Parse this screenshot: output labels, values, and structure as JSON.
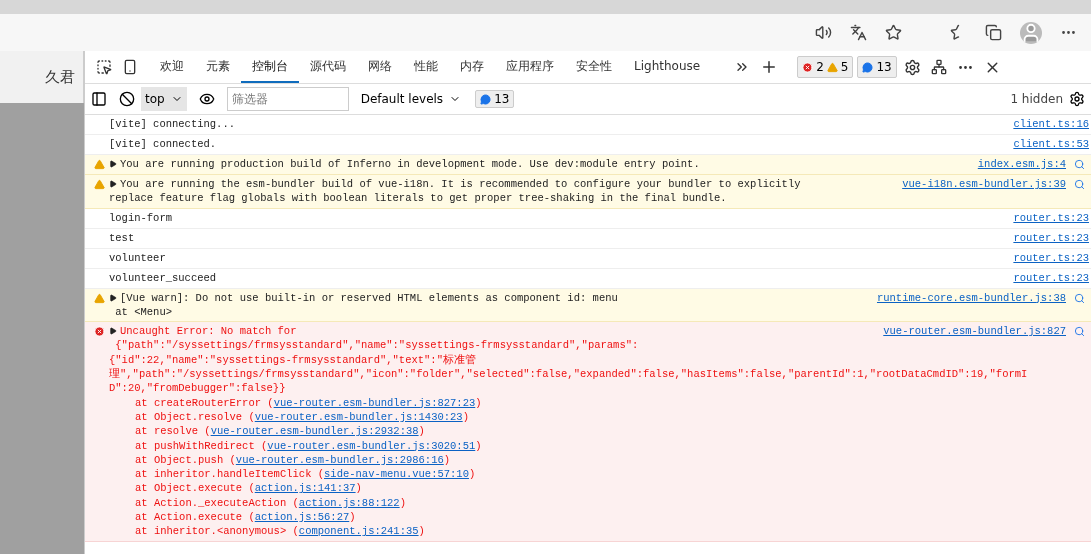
{
  "page": {
    "text": "久君"
  },
  "devtools": {
    "tabs": [
      {
        "label": "欢迎",
        "selected": false
      },
      {
        "label": "元素",
        "selected": false
      },
      {
        "label": "控制台",
        "selected": true
      },
      {
        "label": "源代码",
        "selected": false
      },
      {
        "label": "网络",
        "selected": false
      },
      {
        "label": "性能",
        "selected": false
      },
      {
        "label": "内存",
        "selected": false
      },
      {
        "label": "应用程序",
        "selected": false
      },
      {
        "label": "安全性",
        "selected": false
      },
      {
        "label": "Lighthouse",
        "selected": false
      }
    ],
    "error_count": "2",
    "warning_count": "5",
    "message_count": "13"
  },
  "console_toolbar": {
    "context": "top",
    "filter_placeholder": "筛选器",
    "levels": "Default levels",
    "message_count": "13",
    "hidden": "1 hidden"
  },
  "messages": [
    {
      "kind": "log",
      "lines": [
        "[vite] connecting..."
      ],
      "source": "client.ts:16"
    },
    {
      "kind": "log",
      "lines": [
        "[vite] connected."
      ],
      "source": "client.ts:53"
    },
    {
      "kind": "warning",
      "lines": [
        "You are running production build of Inferno in development mode. Use dev:module entry point."
      ],
      "source": "index.esm.js:4"
    },
    {
      "kind": "warning",
      "lines": [
        "You are running the esm-bundler build of vue-i18n. It is recommended to configure your bundler to explicitly",
        "replace feature flag globals with boolean literals to get proper tree-shaking in the final bundle."
      ],
      "source": "vue-i18n.esm-bundler.js:39"
    },
    {
      "kind": "log",
      "lines": [
        "login-form"
      ],
      "source": "router.ts:23"
    },
    {
      "kind": "log",
      "lines": [
        "test"
      ],
      "source": "router.ts:23"
    },
    {
      "kind": "log",
      "lines": [
        "volunteer"
      ],
      "source": "router.ts:23"
    },
    {
      "kind": "log",
      "lines": [
        "volunteer_succeed"
      ],
      "source": "router.ts:23"
    },
    {
      "kind": "warning",
      "lines": [
        "[Vue warn]: Do not use built-in or reserved HTML elements as component id: menu",
        " at <Menu>"
      ],
      "source": "runtime-core.esm-bundler.js:38"
    },
    {
      "kind": "error",
      "lines": [
        "Uncaught Error: No match for",
        " {\"path\":\"/syssettings/frmsysstandard\",\"name\":\"syssettings-frmsysstandard\",\"params\":",
        "{\"id\":22,\"name\":\"syssettings-frmsysstandard\",\"text\":\"标准管",
        "理\",\"path\":\"/syssettings/frmsysstandard\",\"icon\":\"folder\",\"selected\":false,\"expanded\":false,\"hasItems\":false,\"parentId\":1,\"rootDataCmdID\":19,\"formI",
        "D\":20,\"fromDebugger\":false}}"
      ],
      "source": "vue-router.esm-bundler.js:827",
      "stack": [
        {
          "call": "at createRouterError (",
          "link": "vue-router.esm-bundler.js:827:23",
          "end": ")"
        },
        {
          "call": "at Object.resolve (",
          "link": "vue-router.esm-bundler.js:1430:23",
          "end": ")"
        },
        {
          "call": "at resolve (",
          "link": "vue-router.esm-bundler.js:2932:38",
          "end": ")"
        },
        {
          "call": "at pushWithRedirect (",
          "link": "vue-router.esm-bundler.js:3020:51",
          "end": ")"
        },
        {
          "call": "at Object.push (",
          "link": "vue-router.esm-bundler.js:2986:16",
          "end": ")"
        },
        {
          "call": "at inheritor.handleItemClick (",
          "link": "side-nav-menu.vue:57:10",
          "end": ")"
        },
        {
          "call": "at Object.execute (",
          "link": "action.js:141:37",
          "end": ")"
        },
        {
          "call": "at Action._executeAction (",
          "link": "action.js:88:122",
          "end": ")"
        },
        {
          "call": "at Action.execute (",
          "link": "action.js:56:27",
          "end": ")"
        },
        {
          "call": "at inheritor.<anonymous> (",
          "link": "component.js:241:35",
          "end": ")"
        }
      ]
    }
  ]
}
